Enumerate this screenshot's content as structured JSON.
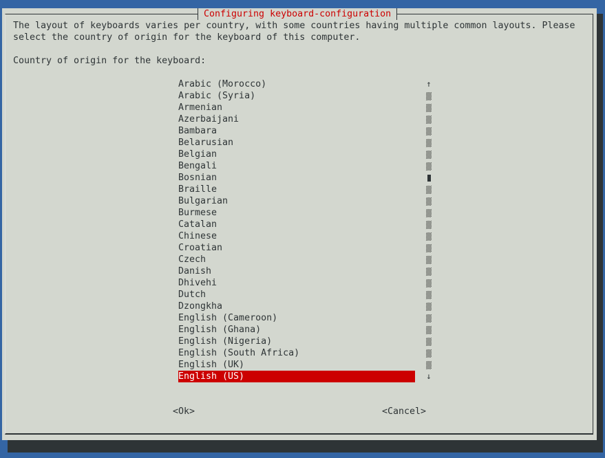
{
  "dialog": {
    "title": "Configuring keyboard-configuration",
    "description_line1": "The layout of keyboards varies per country, with some countries having multiple common layouts. Please",
    "description_line2": "select the country of origin for the keyboard of this computer.",
    "prompt": "Country of origin for the keyboard:"
  },
  "list": {
    "items": [
      "Arabic (Morocco)",
      "Arabic (Syria)",
      "Armenian",
      "Azerbaijani",
      "Bambara",
      "Belarusian",
      "Belgian",
      "Bengali",
      "Bosnian",
      "Braille",
      "Bulgarian",
      "Burmese",
      "Catalan",
      "Chinese",
      "Croatian",
      "Czech",
      "Danish",
      "Dhivehi",
      "Dutch",
      "Dzongkha",
      "English (Cameroon)",
      "English (Ghana)",
      "English (Nigeria)",
      "English (South Africa)",
      "English (UK)",
      "English (US)"
    ],
    "selected": "English (US)",
    "scroll_up_icon": "↑",
    "scroll_down_icon": "↓",
    "scroll_thumb_row": 8
  },
  "buttons": {
    "ok": "<Ok>",
    "cancel": "<Cancel>"
  },
  "colors": {
    "background": "#3465a4",
    "dialog": "#d3d7cf",
    "accent": "#cc0000"
  }
}
